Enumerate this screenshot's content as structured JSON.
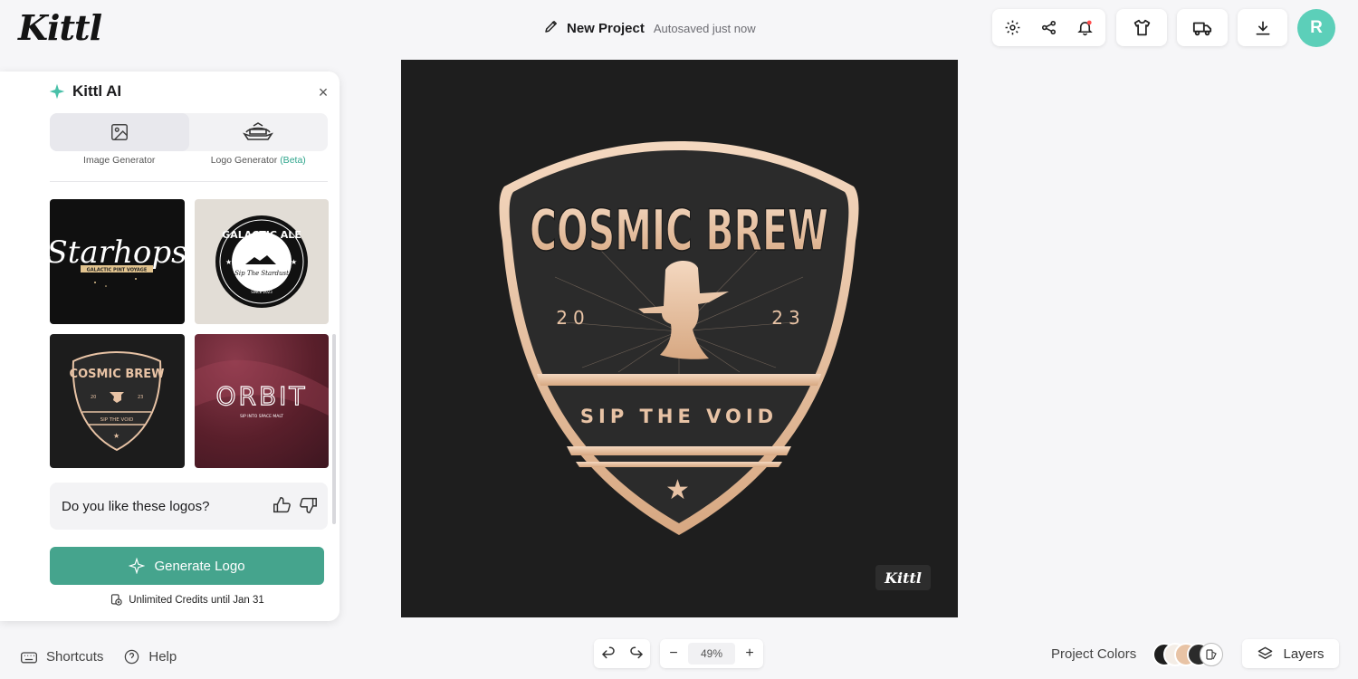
{
  "app": {
    "logo": "Kittl"
  },
  "project": {
    "name": "New Project",
    "autosave": "Autosaved just now"
  },
  "user": {
    "initial": "R"
  },
  "panel": {
    "title": "Kittl AI",
    "tabs": [
      {
        "label": "Image Generator",
        "active": false
      },
      {
        "label": "Logo Generator",
        "badge": "(Beta)",
        "active": true
      }
    ],
    "thumbnails": [
      {
        "title": "Starhops",
        "subtitle": "GALACTIC PINT VOYAGE"
      },
      {
        "title": "GALACTIC ALE",
        "subtitle": "Sip The Stardust",
        "year": "SINCE 2023"
      },
      {
        "title": "COSMIC BREW",
        "year_left": "20",
        "year_right": "23",
        "subtitle": "SIP THE VOID"
      },
      {
        "title": "ORBIT",
        "subtitle": "SIP INTO SPACE MALT"
      }
    ],
    "feedback_question": "Do you like these logos?",
    "generate_label": "Generate Logo",
    "credits": "Unlimited Credits until Jan 31"
  },
  "canvas": {
    "title": "COSMIC BREW",
    "year_left": "20",
    "year_right": "23",
    "tagline": "SIP THE VOID",
    "watermark": "Kittl"
  },
  "footer": {
    "shortcuts": "Shortcuts",
    "help": "Help",
    "zoom": "49%",
    "project_colors": "Project Colors",
    "layers": "Layers"
  },
  "colors": {
    "accent": "#45a48d",
    "avatar": "#5ccfb9",
    "badge_gold": "#e8c3a5",
    "canvas_bg": "#1e1e1e"
  }
}
